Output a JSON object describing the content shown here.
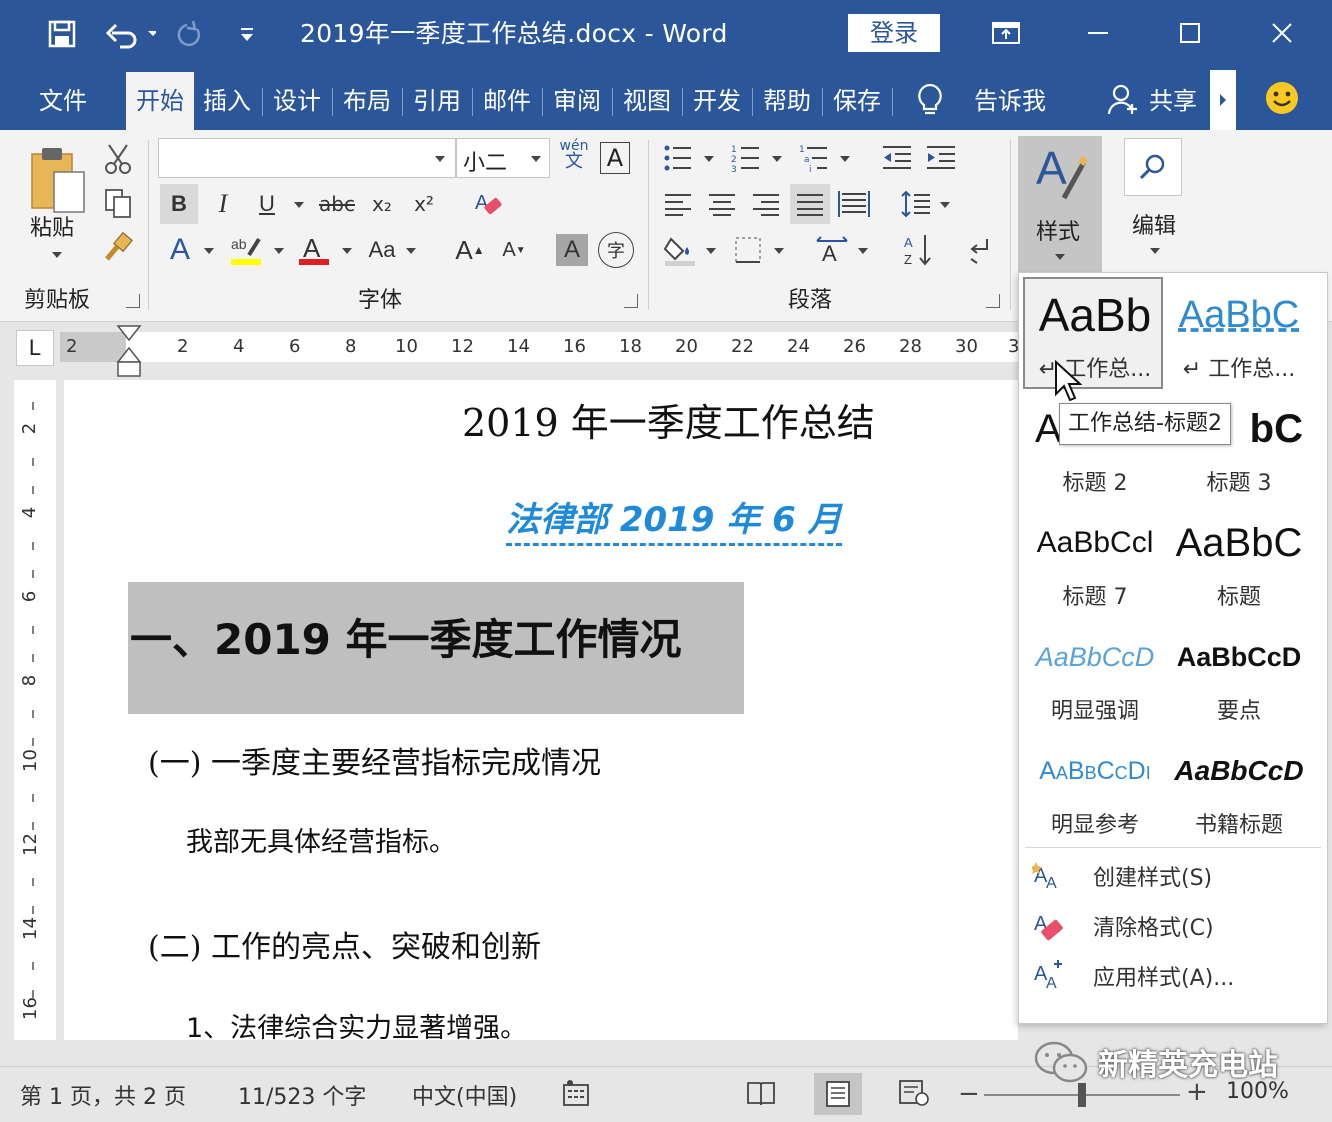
{
  "window": {
    "doc_title": "2019年一季度工作总结.docx  -  Word",
    "login_label": "登录"
  },
  "tabs": [
    "文件",
    "开始",
    "插入",
    "设计",
    "布局",
    "引用",
    "邮件",
    "审阅",
    "视图",
    "开发",
    "帮助",
    "保存"
  ],
  "tell_me": "告诉我",
  "share": "共享",
  "ribbon": {
    "clipboard": {
      "paste_label": "粘贴",
      "group_label": "剪贴板"
    },
    "font": {
      "font_name": "",
      "font_size": "小二",
      "bold": "B",
      "italic": "I",
      "underline": "U",
      "strike": "abc",
      "sub": "x₂",
      "sup": "x²",
      "case": "Aa",
      "grow": "A",
      "shrink": "A",
      "pinyin_top": "wén",
      "pinyin_bottom": "文",
      "enclose": "字",
      "group_label": "字体"
    },
    "paragraph": {
      "group_label": "段落"
    },
    "styles": {
      "label": "样式"
    },
    "editing": {
      "label": "编辑"
    }
  },
  "ruler": {
    "corner": "L",
    "h_numbers": [
      "2",
      "2",
      "4",
      "6",
      "8",
      "10",
      "12",
      "14",
      "16",
      "18",
      "20",
      "22",
      "24",
      "26",
      "28",
      "30",
      "3"
    ],
    "v_numbers": [
      "2",
      "4",
      "6",
      "8",
      "10",
      "12",
      "14",
      "16"
    ]
  },
  "document": {
    "title": "2019 年一季度工作总结",
    "byline": "法律部 2019 年 6 月",
    "heading1": "一、2019 年一季度工作情况",
    "sub1": "(一)  一季度主要经营指标完成情况",
    "para1": "我部无具体经营指标。",
    "sub2": "(二)  工作的亮点、突破和创新",
    "item1": "1、法律综合实力显著增强。"
  },
  "gallery": {
    "cells": [
      {
        "preview": "AaBb",
        "name": "↵ 工作总...",
        "color": "#111111",
        "style": "normal"
      },
      {
        "preview": "AaBbC",
        "name": "↵ 工作总...",
        "color": "#2e8bd0",
        "style": "dashed"
      },
      {
        "preview": "A",
        "name": "标题 2",
        "color": "#111111",
        "style": "normal"
      },
      {
        "preview": "bC",
        "name": "标题 3",
        "color": "#111111",
        "style": "normal"
      },
      {
        "preview": "AaBbCcl",
        "name": "标题 7",
        "color": "#111111",
        "style": "normal"
      },
      {
        "preview": "AaBbC",
        "name": "标题",
        "color": "#111111",
        "style": "normal"
      },
      {
        "preview": "AaBbCcD",
        "name": "明显强调",
        "color": "#5aa3d8",
        "style": "italic"
      },
      {
        "preview": "AaBbCcD",
        "name": "要点",
        "color": "#111111",
        "style": "bold"
      },
      {
        "preview": "AaBbCcDi",
        "name": "明显参考",
        "color": "#2e8bd0",
        "style": "smallcaps"
      },
      {
        "preview": "AaBbCcD",
        "name": "书籍标题",
        "color": "#111111",
        "style": "bolditalic"
      }
    ],
    "tooltip": "工作总结-标题2",
    "menu": [
      "创建样式(S)",
      "清除格式(C)",
      "应用样式(A)..."
    ]
  },
  "status": {
    "page": "第 1 页，共 2 页",
    "words": "11/523 个字",
    "lang": "中文(中国)",
    "zoom": "100%",
    "zoom_fraction": 0.5
  },
  "watermark": "新精英充电站",
  "colors": {
    "accent": "#2b579a",
    "link_blue": "#1f8ad8",
    "heading_bg": "#bfbfbf"
  }
}
